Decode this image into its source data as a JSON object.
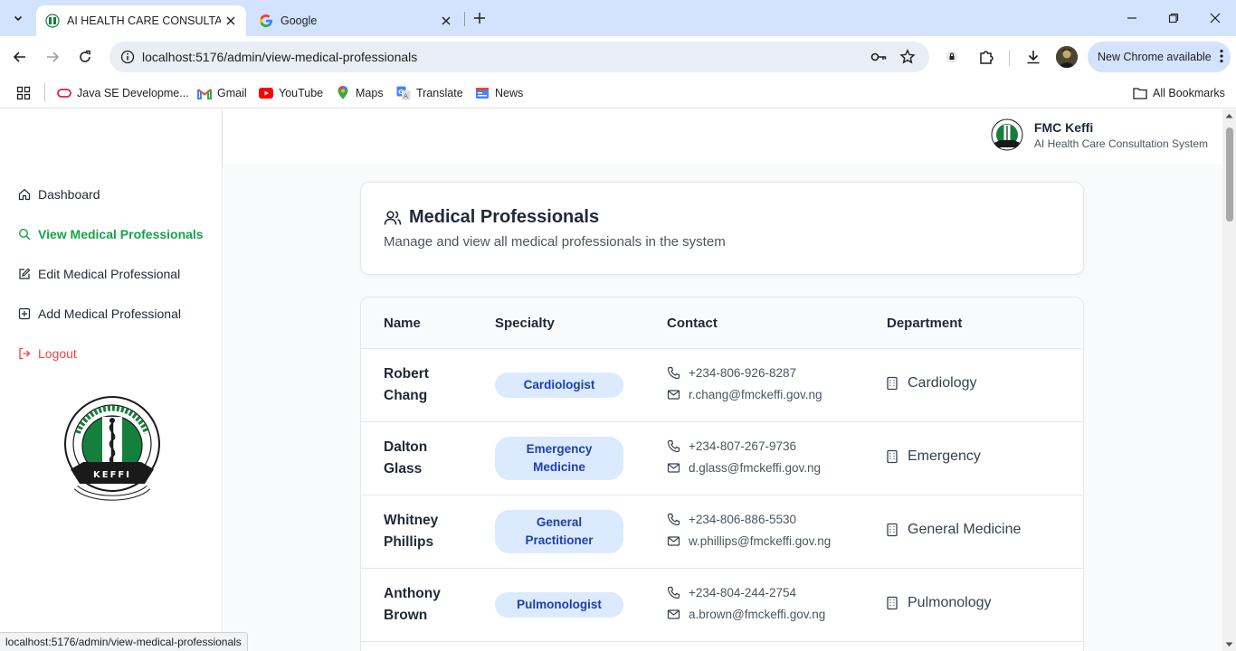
{
  "browser": {
    "tabs": [
      {
        "title": "AI HEALTH CARE CONSULTATIO",
        "active": true
      },
      {
        "title": "Google",
        "active": false
      }
    ],
    "url": "localhost:5176/admin/view-medical-professionals",
    "new_chrome_label": "New Chrome available",
    "bookmarks": [
      {
        "label": "Java SE Developme...",
        "icon": "java-icon"
      },
      {
        "label": "Gmail",
        "icon": "gmail-icon"
      },
      {
        "label": "YouTube",
        "icon": "youtube-icon"
      },
      {
        "label": "Maps",
        "icon": "maps-icon"
      },
      {
        "label": "Translate",
        "icon": "translate-icon"
      },
      {
        "label": "News",
        "icon": "news-icon"
      }
    ],
    "all_bookmarks_label": "All Bookmarks",
    "status_url": "localhost:5176/admin/view-medical-professionals"
  },
  "header": {
    "org_name": "FMC Keffi",
    "system_name": "AI Health Care Consultation System"
  },
  "sidebar": {
    "items": [
      {
        "label": "Dashboard",
        "icon": "home-icon"
      },
      {
        "label": "View Medical Professionals",
        "icon": "search-icon",
        "active": true
      },
      {
        "label": "Edit Medical Professional",
        "icon": "edit-icon"
      },
      {
        "label": "Add Medical Professional",
        "icon": "plus-square-icon"
      },
      {
        "label": "Logout",
        "icon": "logout-icon"
      }
    ]
  },
  "page": {
    "title": "Medical Professionals",
    "description": "Manage and view all medical professionals in the system"
  },
  "table": {
    "columns": [
      "Name",
      "Specialty",
      "Contact",
      "Department"
    ],
    "rows": [
      {
        "first": "Robert",
        "last": "Chang",
        "specialty": "Cardiologist",
        "phone": "+234-806-926-8287",
        "email": "r.chang@fmckeffi.gov.ng",
        "department": "Cardiology"
      },
      {
        "first": "Dalton",
        "last": "Glass",
        "specialty_line1": "Emergency",
        "specialty_line2": "Medicine",
        "phone": "+234-807-267-9736",
        "email": "d.glass@fmckeffi.gov.ng",
        "department": "Emergency"
      },
      {
        "first": "Whitney",
        "last": "Phillips",
        "specialty_line1": "General",
        "specialty_line2": "Practitioner",
        "phone": "+234-806-886-5530",
        "email": "w.phillips@fmckeffi.gov.ng",
        "department": "General Medicine"
      },
      {
        "first": "Anthony",
        "last": "Brown",
        "specialty": "Pulmonologist",
        "phone": "+234-804-244-2754",
        "email": "a.brown@fmckeffi.gov.ng",
        "department": "Pulmonology"
      }
    ]
  },
  "colors": {
    "accent_green": "#16a34a",
    "logout_red": "#ef4444",
    "badge_bg": "#dbeafe",
    "badge_text": "#1e40af",
    "chrome_tabstrip": "#d3e3fd"
  }
}
